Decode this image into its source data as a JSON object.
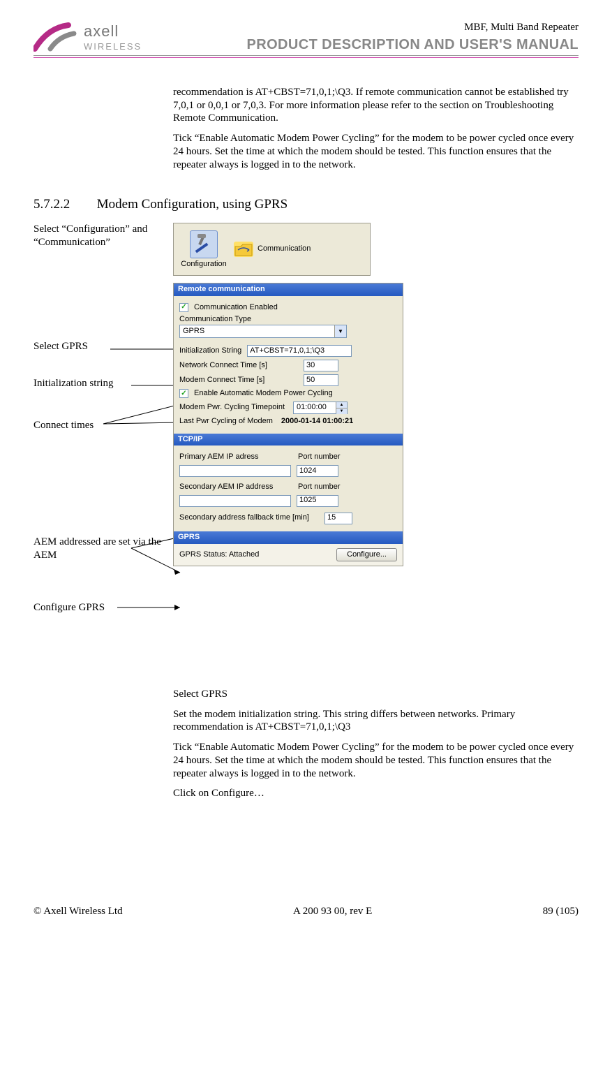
{
  "header": {
    "brand_line1": "axell",
    "brand_line2": "WIRELESS",
    "title_line1": "MBF, Multi Band Repeater",
    "title_line2": "PRODUCT DESCRIPTION AND USER'S MANUAL"
  },
  "intro_paras": [
    "recommendation is AT+CBST=71,0,1;\\Q3. If remote communication cannot be established try 7,0,1 or 0,0,1 or 7,0,3. For more information please refer to the section on Troubleshooting Remote Communication.",
    "Tick “Enable Automatic Modem Power Cycling” for the modem to be power cycled once every 24 hours. Set the time at which the modem should be tested. This function ensures that the repeater always is logged in to the network."
  ],
  "section": {
    "number": "5.7.2.2",
    "title": "Modem Configuration, using GPRS"
  },
  "annotations": {
    "step1": "Select “Configuration” and “Communication”",
    "select_gprs": "Select GPRS",
    "init_string": "Initialization string",
    "connect_times": "Connect times",
    "aem": "AEM addressed are set via the AEM",
    "configure": "Configure GPRS"
  },
  "toolbar": {
    "config_label": "Configuration",
    "comm_label": "Communication"
  },
  "panel": {
    "remote_header": "Remote communication",
    "comm_enabled": "Communication Enabled",
    "comm_type_label": "Communication Type",
    "comm_type_value": "GPRS",
    "init_label": "Initialization String",
    "init_value": "AT+CBST=71,0,1;\\Q3",
    "net_time_label": "Network Connect Time [s]",
    "net_time_value": "30",
    "modem_time_label": "Modem Connect Time [s]",
    "modem_time_value": "50",
    "auto_cycle": "Enable Automatic Modem Power Cycling",
    "cycle_timepoint_label": "Modem Pwr. Cycling Timepoint",
    "cycle_timepoint_value": "01:00:00",
    "last_cycle_label": "Last Pwr Cycling of Modem",
    "last_cycle_value": "2000-01-14    01:00:21",
    "tcp_header": "TCP/IP",
    "prim_ip_label": "Primary AEM IP adress",
    "port_label": "Port number",
    "prim_port": "1024",
    "sec_ip_label": "Secondary AEM IP address",
    "sec_port": "1025",
    "fallback_label": "Secondary address fallback time [min]",
    "fallback_value": "15",
    "gprs_header": "GPRS",
    "gprs_status_label": "GPRS Status: Attached",
    "configure_btn": "Configure..."
  },
  "post_paras": [
    "Select GPRS",
    "Set the modem initialization string. This string differs between networks. Primary recommendation is AT+CBST=71,0,1;\\Q3",
    "Tick “Enable Automatic Modem Power Cycling” for the modem to be power cycled once every 24 hours. Set the time at which the modem should be tested. This function ensures that the repeater always is logged in to the network.",
    "Click on Configure…"
  ],
  "footer": {
    "left": "© Axell Wireless Ltd",
    "center": "A 200 93 00, rev E",
    "right": "89 (105)"
  }
}
